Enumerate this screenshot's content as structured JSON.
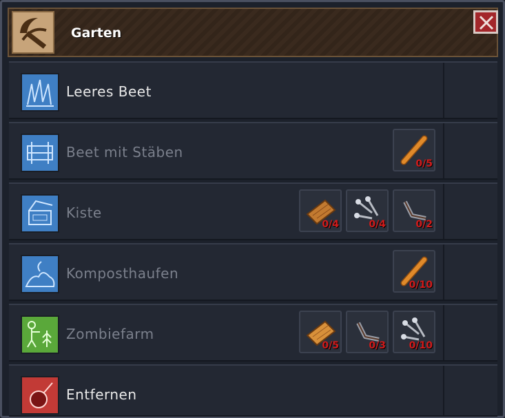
{
  "window": {
    "title": "Garten",
    "close_icon": "close-icon"
  },
  "rows": [
    {
      "label": "Leeres Beet",
      "icon": "blueprint-grass-icon",
      "available": true,
      "requirements": []
    },
    {
      "label": "Beet mit Stäben",
      "icon": "blueprint-fence-icon",
      "available": false,
      "requirements": [
        {
          "item": "stick-icon",
          "count": "0/5"
        }
      ]
    },
    {
      "label": "Kiste",
      "icon": "blueprint-crate-icon",
      "available": false,
      "requirements": [
        {
          "item": "plank-icon",
          "count": "0/4"
        },
        {
          "item": "nails-icon",
          "count": "0/4"
        },
        {
          "item": "bracket-icon",
          "count": "0/2"
        }
      ]
    },
    {
      "label": "Komposthaufen",
      "icon": "blueprint-compost-icon",
      "available": false,
      "requirements": [
        {
          "item": "stick-icon",
          "count": "0/10"
        }
      ]
    },
    {
      "label": "Zombiefarm",
      "icon": "zombie-farm-icon",
      "available": false,
      "requirements": [
        {
          "item": "plank-icon",
          "count": "0/5"
        },
        {
          "item": "bracket-icon",
          "count": "0/3"
        },
        {
          "item": "nails-icon",
          "count": "0/10"
        }
      ]
    },
    {
      "label": "Entfernen",
      "icon": "remove-bomb-icon",
      "available": true,
      "requirements": []
    }
  ],
  "colors": {
    "blueprint": "#3f7fc4",
    "green": "#5aa83a",
    "red": "#c23a36",
    "count": "#d11a1a"
  }
}
